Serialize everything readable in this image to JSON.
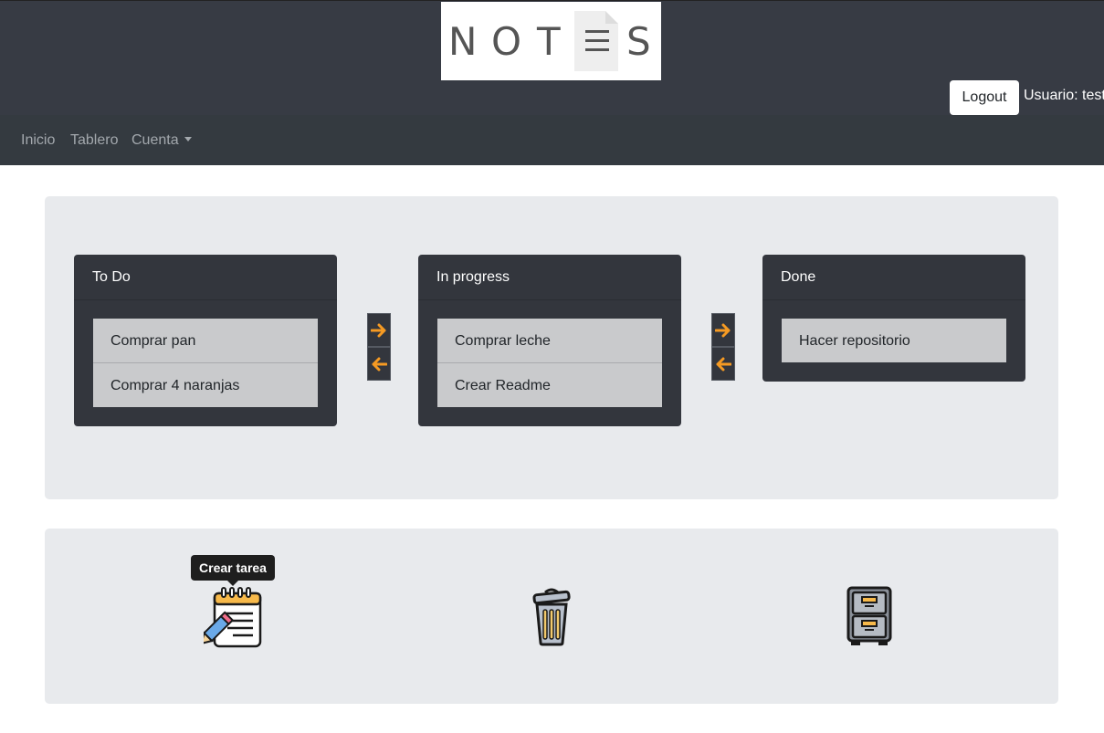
{
  "header": {
    "logo_letters": [
      "N",
      "O",
      "T",
      "S"
    ],
    "logout_label": "Logout",
    "user_label": "Usuario: test"
  },
  "nav": {
    "items": [
      {
        "label": "Inicio"
      },
      {
        "label": "Tablero"
      },
      {
        "label": "Cuenta"
      }
    ]
  },
  "board": {
    "columns": [
      {
        "title": "To Do",
        "cards": [
          "Comprar pan",
          "Comprar 4 naranjas"
        ]
      },
      {
        "title": "In progress",
        "cards": [
          "Comprar leche",
          "Crear Readme"
        ]
      },
      {
        "title": "Done",
        "cards": [
          "Hacer repositorio"
        ]
      }
    ],
    "arrow_color": "#f59a23"
  },
  "actions": {
    "tooltip": "Crear tarea",
    "icons": [
      "create-task-icon",
      "trash-icon",
      "archive-cabinet-icon"
    ]
  }
}
